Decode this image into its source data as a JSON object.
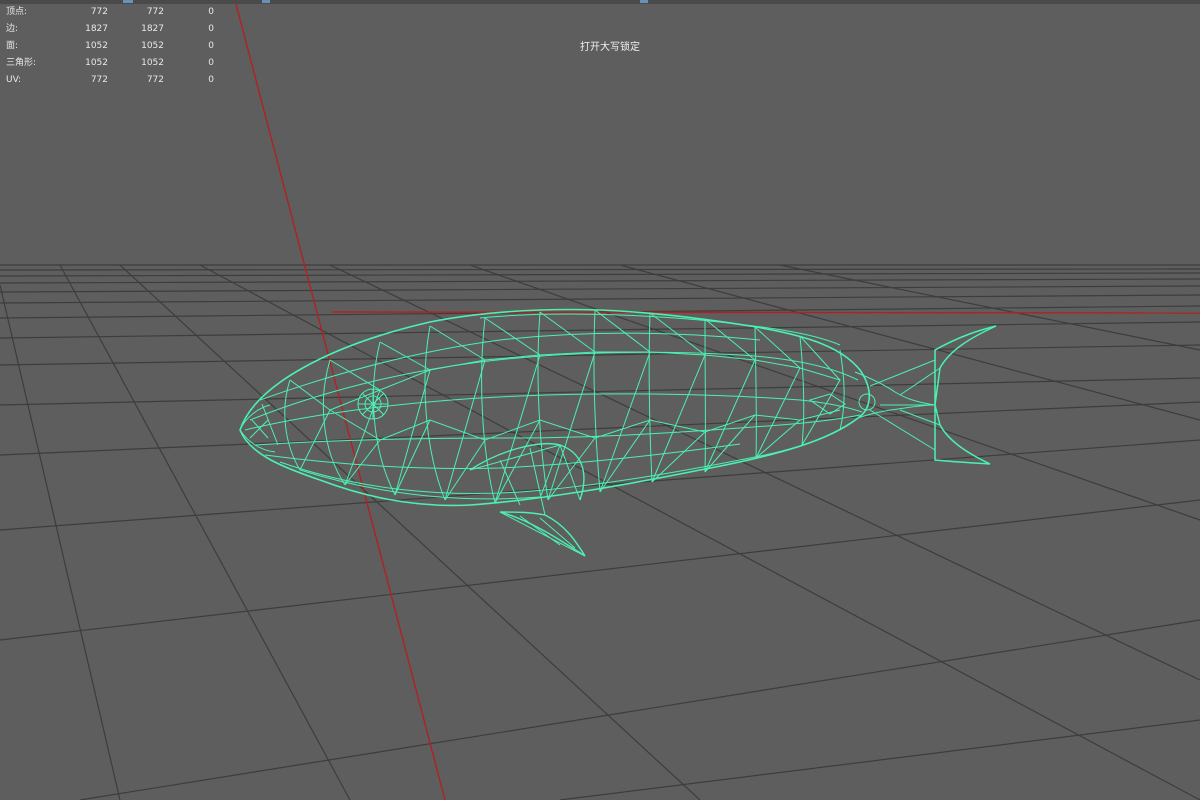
{
  "hud": {
    "rows": [
      {
        "label": "顶点:",
        "v1": "772",
        "v2": "772",
        "v3": "0"
      },
      {
        "label": "边:",
        "v1": "1827",
        "v2": "1827",
        "v3": "0"
      },
      {
        "label": "面:",
        "v1": "1052",
        "v2": "1052",
        "v3": "0"
      },
      {
        "label": "三角形:",
        "v1": "1052",
        "v2": "1052",
        "v3": "0"
      },
      {
        "label": "UV:",
        "v1": "772",
        "v2": "772",
        "v3": "0"
      }
    ]
  },
  "status": {
    "caps_lock": "打开大写锁定"
  },
  "colors": {
    "viewport_bg": "#5e5e5e",
    "grid_line": "#3d3d3d",
    "axis_red": "#b02222",
    "wireframe": "#4cf0b2",
    "text": "#e8e8e8"
  },
  "viewport": {
    "selected_object": "fish-mesh",
    "display_mode": "wireframe"
  }
}
